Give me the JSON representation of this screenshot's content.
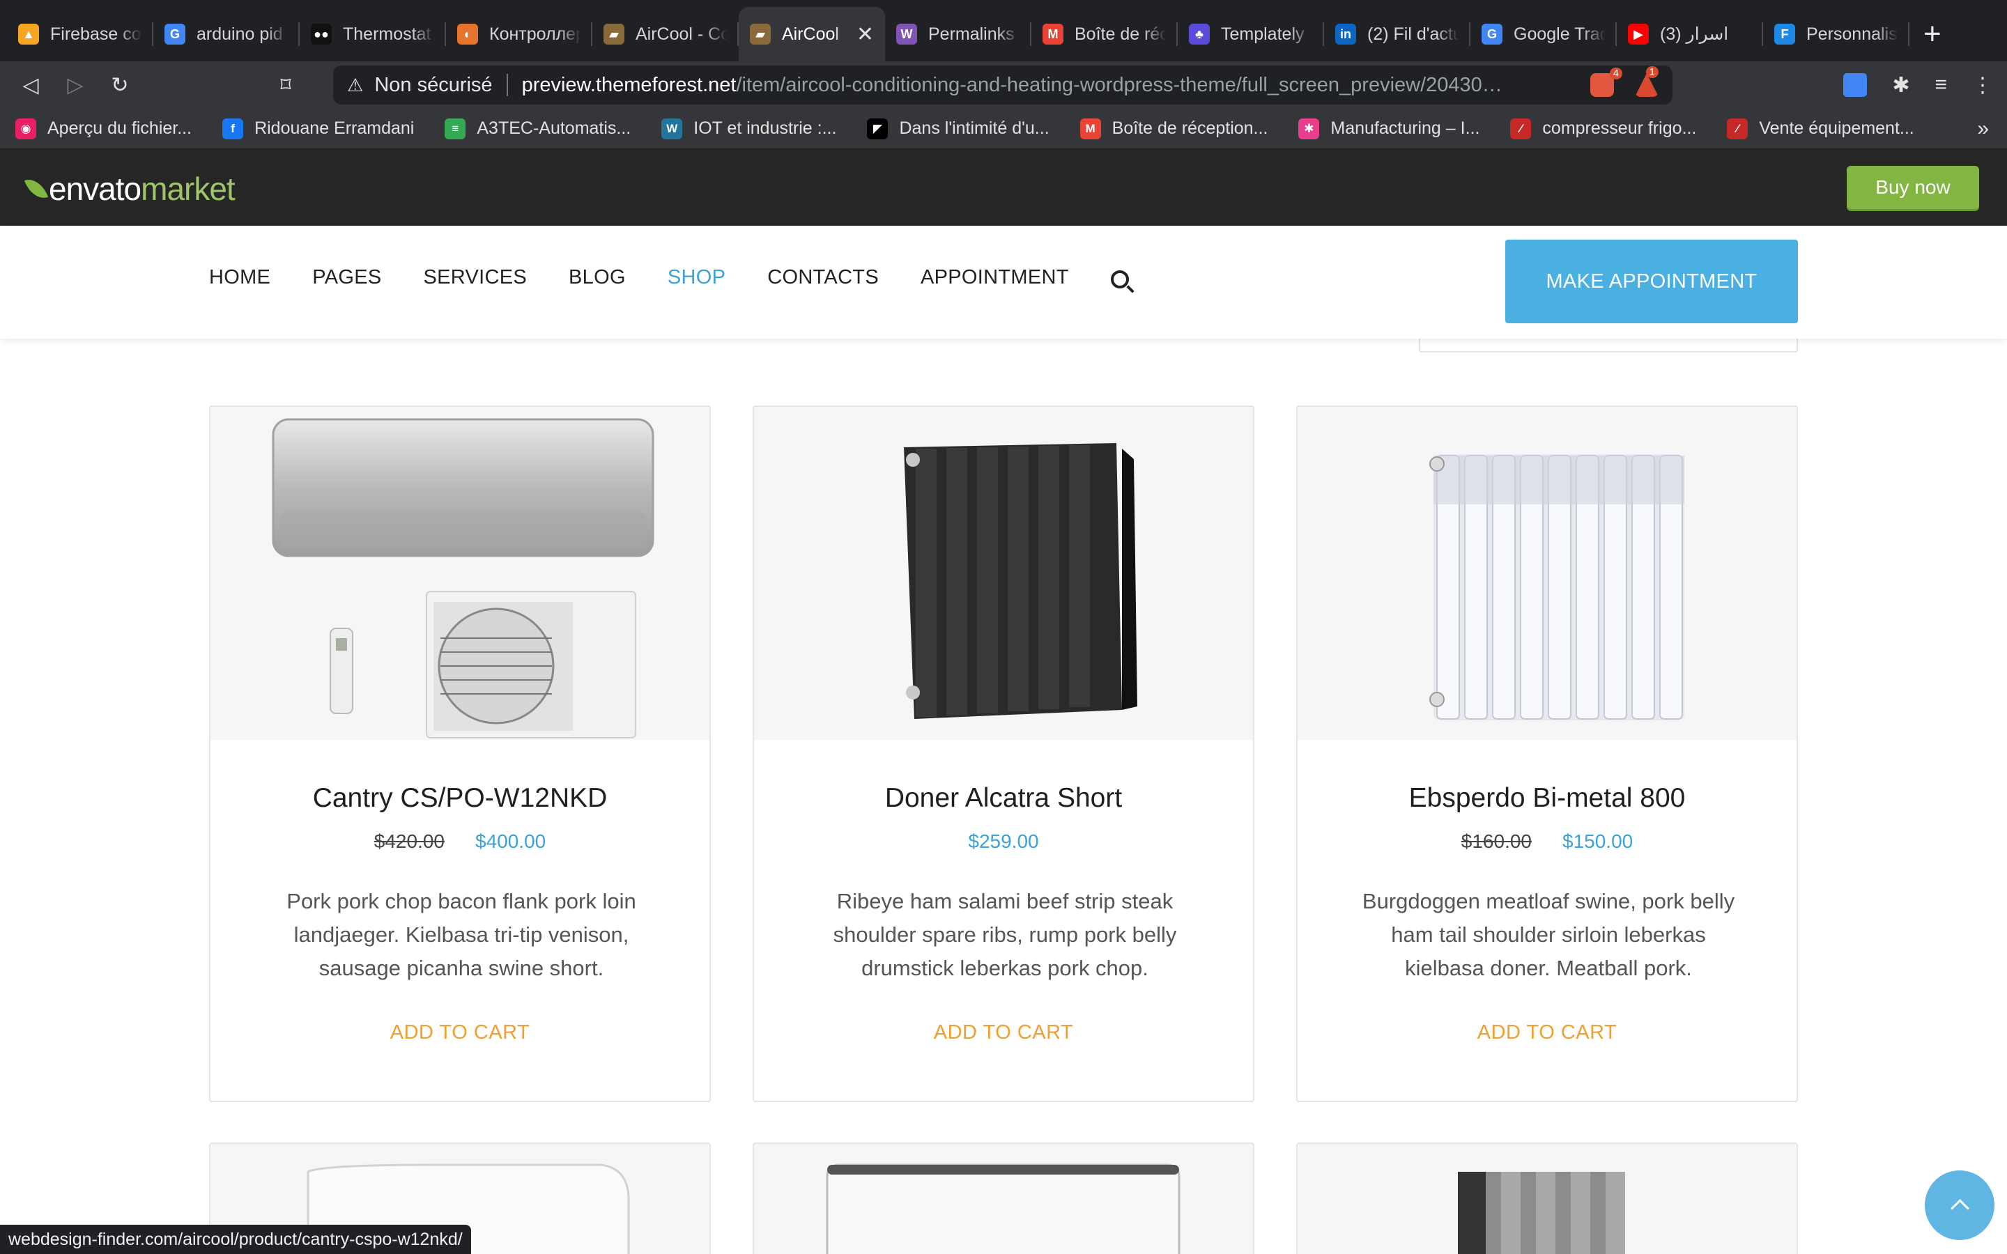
{
  "browser": {
    "tabs": [
      {
        "label": "Firebase console",
        "color": "#f6a623",
        "glyph": "▲"
      },
      {
        "label": "arduino pid",
        "color": "#4285f4",
        "glyph": "G"
      },
      {
        "label": "Thermostat",
        "color": "#111111",
        "glyph": "●●"
      },
      {
        "label": "Контроллер",
        "color": "#e8742c",
        "glyph": "◐"
      },
      {
        "label": "AirCool - Co",
        "color": "#8a6a3a",
        "glyph": "▰"
      },
      {
        "label": "AirCool",
        "color": "#8a6a3a",
        "glyph": "▰",
        "active": true
      },
      {
        "label": "Permalinks",
        "color": "#7f54b3",
        "glyph": "W"
      },
      {
        "label": "Boîte de réc",
        "color": "#ea4335",
        "glyph": "M"
      },
      {
        "label": "Templately",
        "color": "#5b4bdb",
        "glyph": "♣"
      },
      {
        "label": "(2) Fil d'actu",
        "color": "#0a66c2",
        "glyph": "in"
      },
      {
        "label": "Google Trad",
        "color": "#4285f4",
        "glyph": "G"
      },
      {
        "label": "(3) اسرار",
        "color": "#ff0000",
        "glyph": "▶"
      },
      {
        "label": "Personnalis",
        "color": "#1e88e5",
        "glyph": "F"
      }
    ],
    "close_glyph": "✕",
    "newtab_glyph": "+",
    "nav": {
      "back": "◁",
      "forward": "▷",
      "reload": "↻",
      "bookmark": "⌑"
    },
    "url": {
      "warning_icon": "⚠",
      "security_label": "Non sécurisé",
      "host": "preview.themeforest.net",
      "path": "/item/aircool-conditioning-and-heating-wordpress-theme/full_screen_preview/20430…",
      "brave_count": "4",
      "alert_count": "1"
    },
    "bookmarks": [
      {
        "label": "Aperçu du fichier...",
        "color": "#e91e63",
        "glyph": "◉"
      },
      {
        "label": "Ridouane Erramdani",
        "color": "#1877f2",
        "glyph": "f"
      },
      {
        "label": "A3TEC-Automatis...",
        "color": "#34a853",
        "glyph": "≡"
      },
      {
        "label": "IOT et industrie :...",
        "color": "#21759b",
        "glyph": "W"
      },
      {
        "label": "Dans l'intimité d'u...",
        "color": "#000000",
        "glyph": "◤"
      },
      {
        "label": "Boîte de réception...",
        "color": "#ea4335",
        "glyph": "M"
      },
      {
        "label": "Manufacturing – I...",
        "color": "#e83e8c",
        "glyph": "✱"
      },
      {
        "label": "compresseur frigo...",
        "color": "#c62828",
        "glyph": "⁄"
      },
      {
        "label": "Vente équipement...",
        "color": "#c62828",
        "glyph": "⁄"
      }
    ],
    "bookmarks_more": "»",
    "status_url": "webdesign-finder.com/aircool/product/cantry-cspo-w12nkd/"
  },
  "envato": {
    "logo_part1": "envato",
    "logo_part2": "market",
    "buy_label": "Buy now"
  },
  "site": {
    "menu": [
      "HOME",
      "PAGES",
      "SERVICES",
      "BLOG",
      "SHOP",
      "CONTACTS",
      "APPOINTMENT"
    ],
    "active_menu": "SHOP",
    "appointment_label": "MAKE APPOINTMENT"
  },
  "products": [
    {
      "name": "Cantry CS/PO-W12NKD",
      "old_price": "$420.00",
      "price": "$400.00",
      "desc": "Pork pork chop bacon flank pork loin landjaeger. Kielbasa tri-tip venison, sausage picanha swine short.",
      "cart_label": "ADD TO CART"
    },
    {
      "name": "Doner Alcatra Short",
      "old_price": "",
      "price": "$259.00",
      "desc": "Ribeye ham salami beef strip steak shoulder spare ribs, rump pork belly drumstick leberkas pork chop.",
      "cart_label": "ADD TO CART"
    },
    {
      "name": "Ebsperdo Bi-metal 800",
      "old_price": "$160.00",
      "price": "$150.00",
      "desc": "Burgdoggen meatloaf swine, pork belly ham tail shoulder sirloin leberkas kielbasa doner. Meatball pork.",
      "cart_label": "ADD TO CART"
    }
  ],
  "colors": {
    "accent": "#3da3d4",
    "cart": "#f0a030",
    "envato_green": "#82b541"
  }
}
